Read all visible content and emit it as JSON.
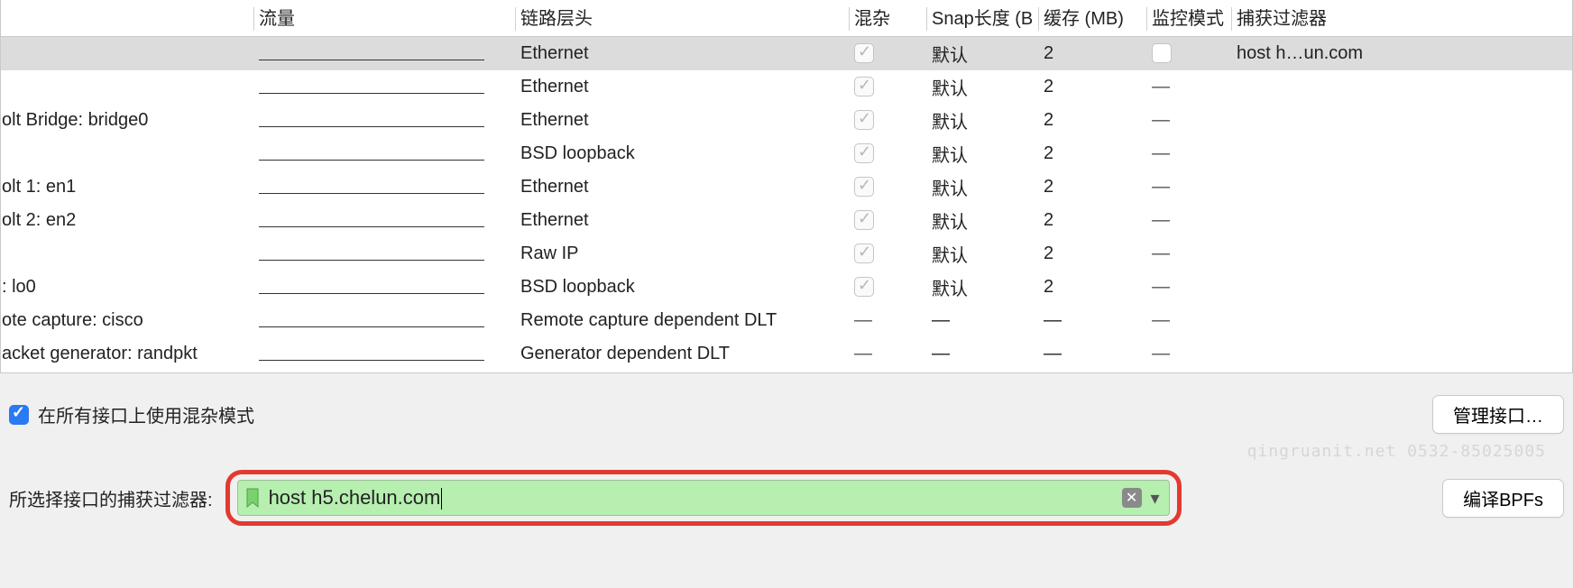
{
  "columns": {
    "interface": "",
    "traffic": "流量",
    "linklayer": "链路层头",
    "promisc": "混杂",
    "snaplen": "Snap长度 (B",
    "buffer": "缓存 (MB)",
    "monitor": "监控模式",
    "filter": "捕获过滤器"
  },
  "rows": [
    {
      "iface": "",
      "link": "Ethernet",
      "promisc": "checked",
      "snap": "默认",
      "buf": "2",
      "monitor": "blank",
      "filter": "host h…un.com",
      "selected": true
    },
    {
      "iface": "",
      "link": "Ethernet",
      "promisc": "checked",
      "snap": "默认",
      "buf": "2",
      "monitor": "dash",
      "filter": ""
    },
    {
      "iface": "olt Bridge: bridge0",
      "link": "Ethernet",
      "promisc": "checked",
      "snap": "默认",
      "buf": "2",
      "monitor": "dash",
      "filter": ""
    },
    {
      "iface": "",
      "link": "BSD loopback",
      "promisc": "checked",
      "snap": "默认",
      "buf": "2",
      "monitor": "dash",
      "filter": ""
    },
    {
      "iface": "olt 1: en1",
      "link": "Ethernet",
      "promisc": "checked",
      "snap": "默认",
      "buf": "2",
      "monitor": "dash",
      "filter": ""
    },
    {
      "iface": "olt 2: en2",
      "link": "Ethernet",
      "promisc": "checked",
      "snap": "默认",
      "buf": "2",
      "monitor": "dash",
      "filter": ""
    },
    {
      "iface": "",
      "link": "Raw IP",
      "promisc": "checked",
      "snap": "默认",
      "buf": "2",
      "monitor": "dash",
      "filter": ""
    },
    {
      "iface": ": lo0",
      "link": "BSD loopback",
      "promisc": "checked",
      "snap": "默认",
      "buf": "2",
      "monitor": "dash",
      "filter": ""
    },
    {
      "iface": "ote capture: cisco",
      "link": "Remote capture dependent DLT",
      "promisc": "dash",
      "snap": "—",
      "buf": "—",
      "monitor": "dash",
      "filter": ""
    },
    {
      "iface": "acket generator: randpkt",
      "link": "Generator dependent DLT",
      "promisc": "dash",
      "snap": "—",
      "buf": "—",
      "monitor": "dash",
      "filter": ""
    }
  ],
  "promisc_all_label": "在所有接口上使用混杂模式",
  "manage_button": "管理接口…",
  "filter_label": "所选择接口的捕获过滤器:",
  "filter_value": "host h5.chelun.com",
  "compile_button": "编译BPFs",
  "watermark": "qingruanit.net 0532-85025005"
}
